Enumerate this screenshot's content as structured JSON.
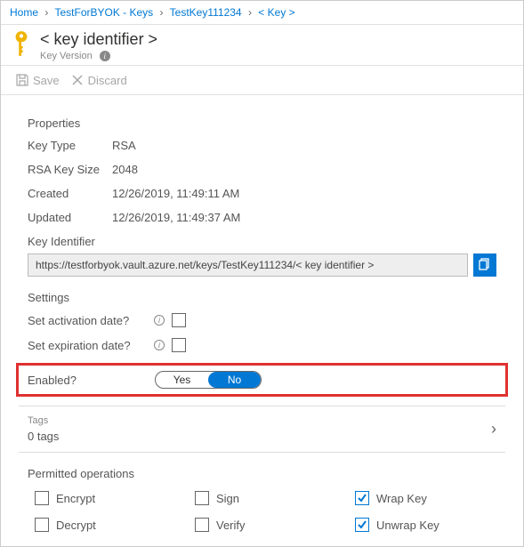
{
  "breadcrumb": {
    "home": "Home",
    "vault": "TestForBYOK - Keys",
    "key": "TestKey111234",
    "version": "< Key >"
  },
  "header": {
    "title": "< key identifier >",
    "subtitle": "Key Version"
  },
  "toolbar": {
    "save": "Save",
    "discard": "Discard"
  },
  "properties": {
    "heading": "Properties",
    "keyTypeLabel": "Key Type",
    "keyTypeValue": "RSA",
    "keySizeLabel": "RSA Key Size",
    "keySizeValue": "2048",
    "createdLabel": "Created",
    "createdValue": "12/26/2019, 11:49:11 AM",
    "updatedLabel": "Updated",
    "updatedValue": "12/26/2019, 11:49:37 AM",
    "keyIdLabel": "Key Identifier",
    "keyIdValue": "https://testforbyok.vault.azure.net/keys/TestKey111234/< key identifier >"
  },
  "settings": {
    "heading": "Settings",
    "activationLabel": "Set activation date?",
    "expirationLabel": "Set expiration date?",
    "enabledLabel": "Enabled?",
    "yes": "Yes",
    "no": "No"
  },
  "tags": {
    "title": "Tags",
    "count": "0 tags"
  },
  "operations": {
    "heading": "Permitted operations",
    "encrypt": "Encrypt",
    "sign": "Sign",
    "wrap": "Wrap Key",
    "decrypt": "Decrypt",
    "verify": "Verify",
    "unwrap": "Unwrap Key"
  }
}
